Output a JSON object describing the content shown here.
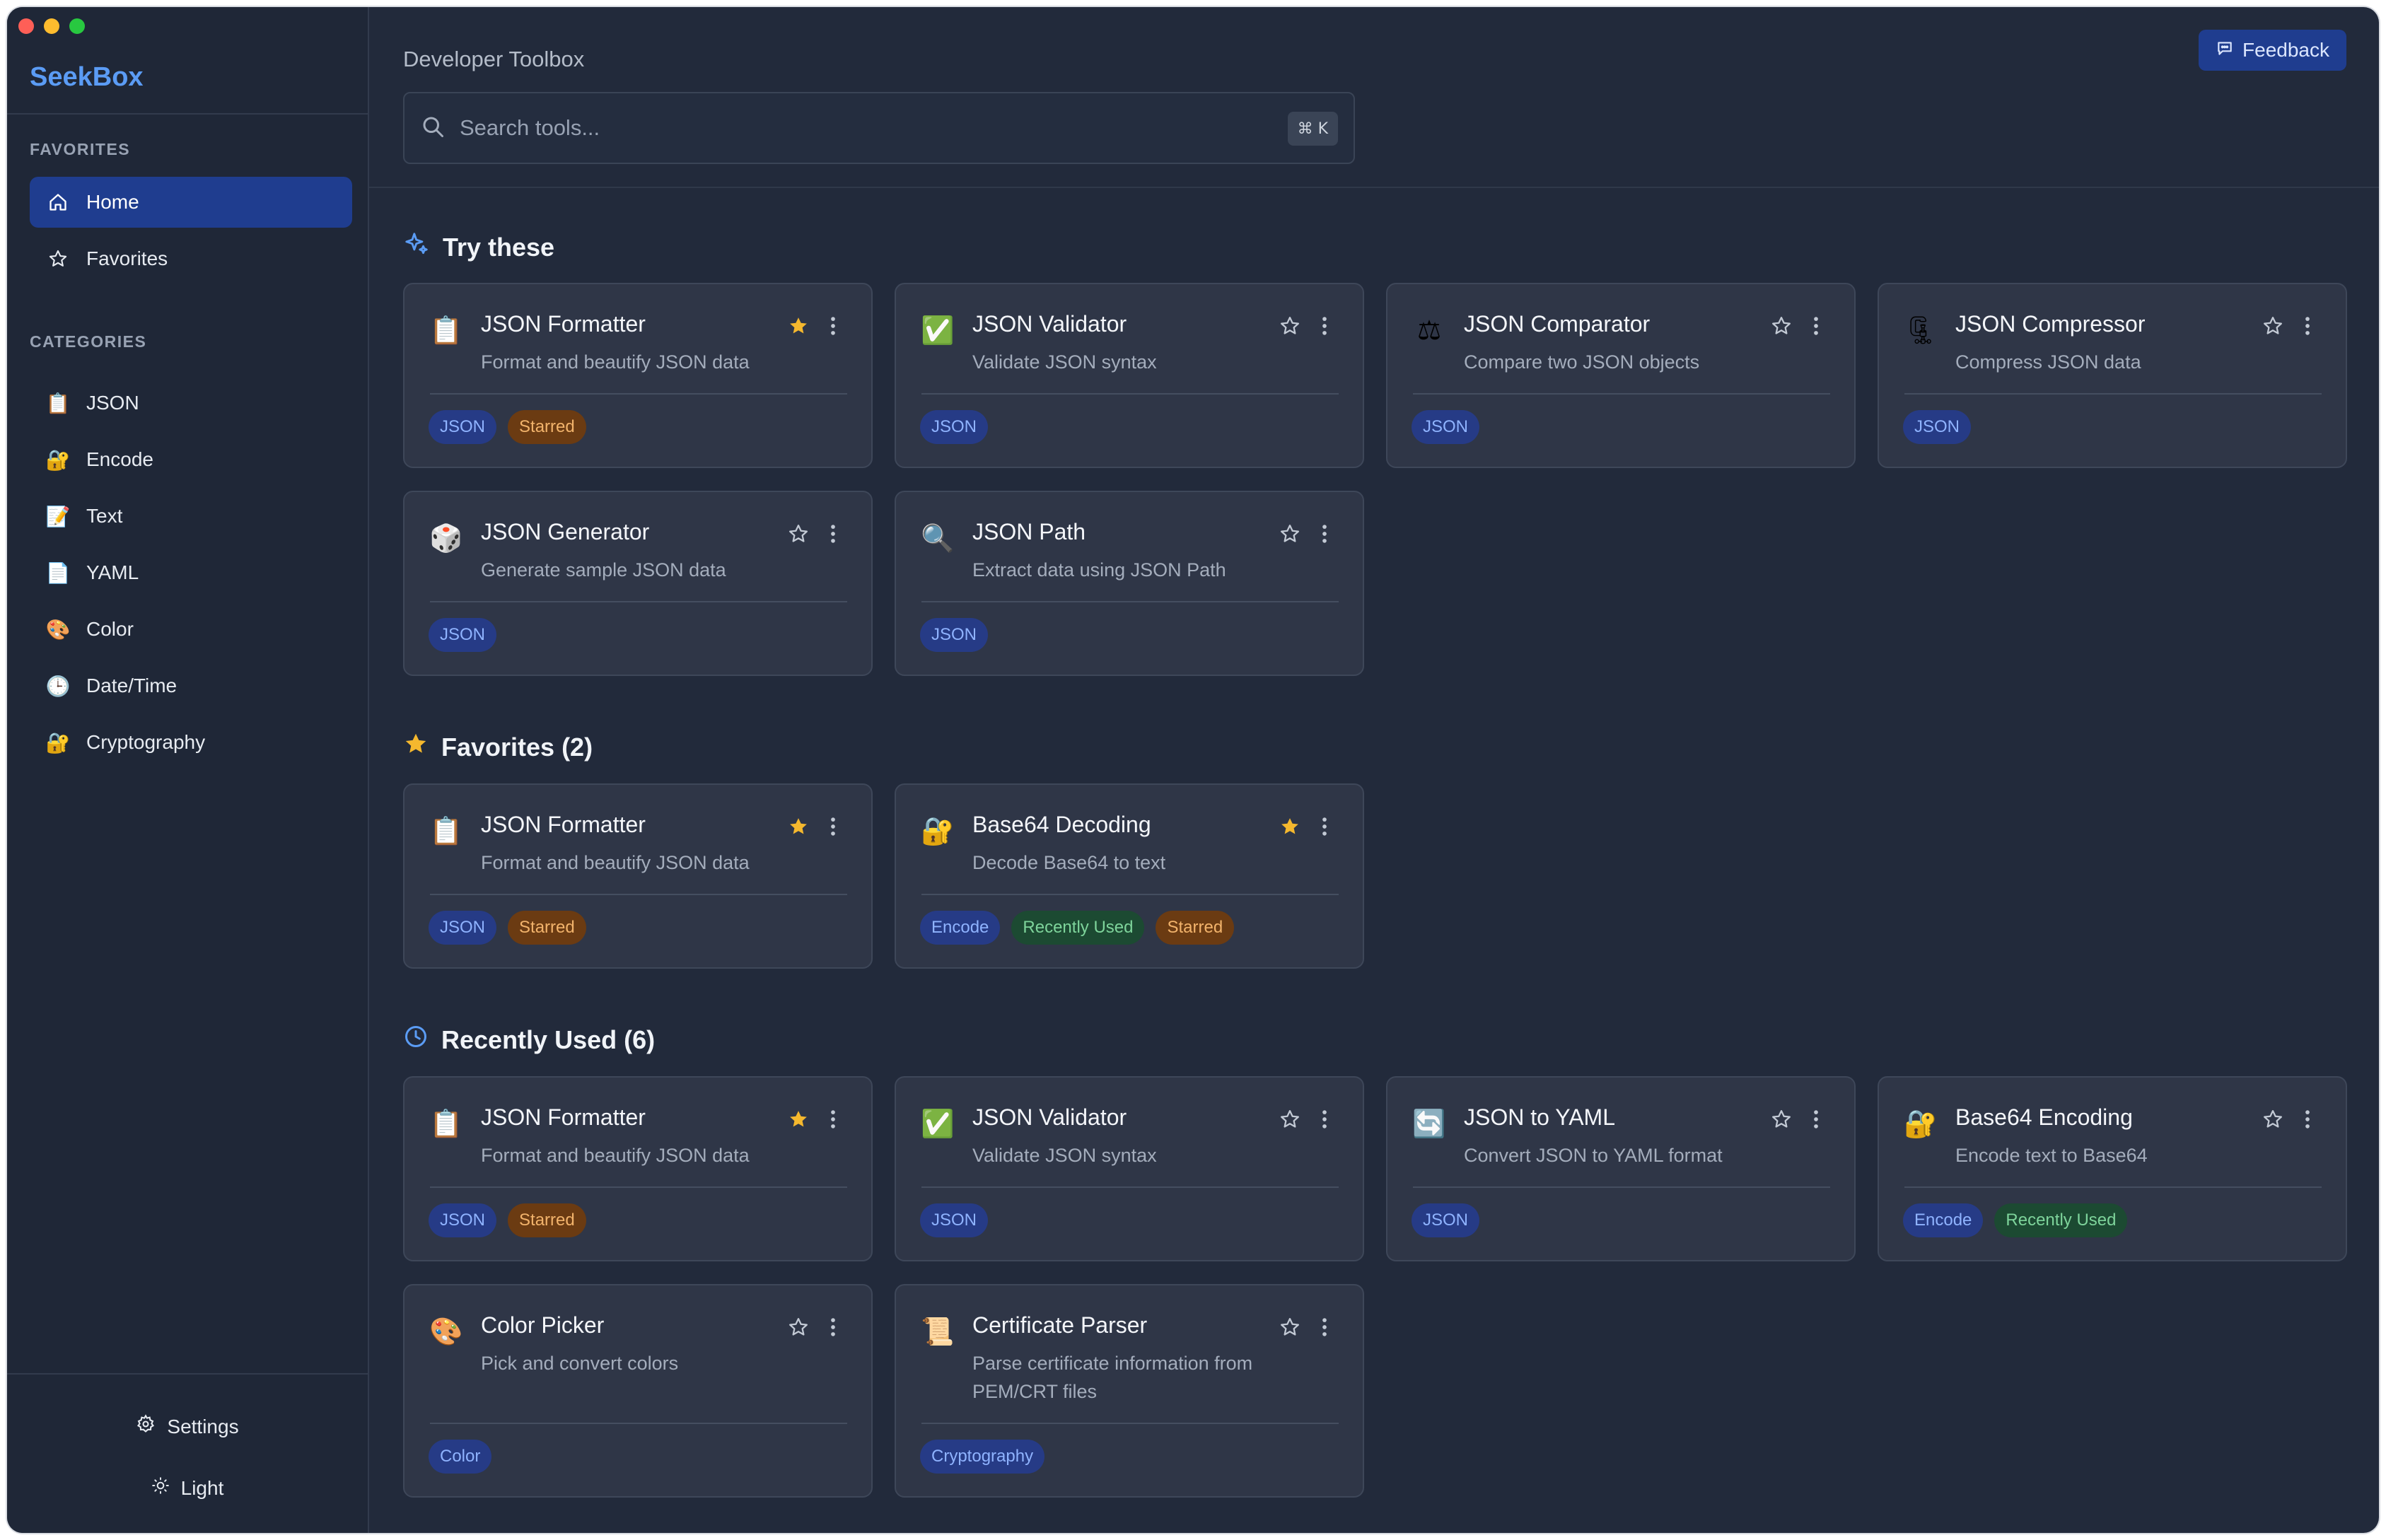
{
  "app": {
    "name": "SeekBox",
    "header_title": "Developer Toolbox",
    "feedback_label": "Feedback"
  },
  "search": {
    "placeholder": "Search tools...",
    "shortcut": "⌘ K"
  },
  "sidebar": {
    "favorites_label": "FAVORITES",
    "nav": [
      {
        "label": "Home",
        "icon": "home-icon",
        "active": true
      },
      {
        "label": "Favorites",
        "icon": "star-outline-icon",
        "active": false
      }
    ],
    "categories_label": "CATEGORIES",
    "categories": [
      {
        "label": "JSON",
        "icon": "clipboard-icon"
      },
      {
        "label": "Encode",
        "icon": "lock-key-icon"
      },
      {
        "label": "Text",
        "icon": "memo-icon"
      },
      {
        "label": "YAML",
        "icon": "page-icon"
      },
      {
        "label": "Color",
        "icon": "palette-icon"
      },
      {
        "label": "Date/Time",
        "icon": "clock-icon"
      },
      {
        "label": "Cryptography",
        "icon": "lock-key-icon"
      }
    ],
    "settings_label": "Settings",
    "theme_label": "Light"
  },
  "sections": {
    "try_these": {
      "title": "Try these",
      "cards": [
        {
          "title": "JSON Formatter",
          "desc": "Format and beautify JSON data",
          "icon": "clipboard-icon",
          "starred": true,
          "tags": [
            {
              "text": "JSON",
              "kind": "blue"
            },
            {
              "text": "Starred",
              "kind": "orange"
            }
          ]
        },
        {
          "title": "JSON Validator",
          "desc": "Validate JSON syntax",
          "icon": "check-box-icon",
          "starred": false,
          "tags": [
            {
              "text": "JSON",
              "kind": "blue"
            }
          ]
        },
        {
          "title": "JSON Comparator",
          "desc": "Compare two JSON objects",
          "icon": "scales-icon",
          "starred": false,
          "tags": [
            {
              "text": "JSON",
              "kind": "blue"
            }
          ]
        },
        {
          "title": "JSON Compressor",
          "desc": "Compress JSON data",
          "icon": "clamp-icon",
          "starred": false,
          "tags": [
            {
              "text": "JSON",
              "kind": "blue"
            }
          ]
        },
        {
          "title": "JSON Generator",
          "desc": "Generate sample JSON data",
          "icon": "dice-icon",
          "starred": false,
          "tags": [
            {
              "text": "JSON",
              "kind": "blue"
            }
          ]
        },
        {
          "title": "JSON Path",
          "desc": "Extract data using JSON Path",
          "icon": "magnifier-icon",
          "starred": false,
          "tags": [
            {
              "text": "JSON",
              "kind": "blue"
            }
          ]
        }
      ]
    },
    "favorites": {
      "title": "Favorites (2)",
      "cards": [
        {
          "title": "JSON Formatter",
          "desc": "Format and beautify JSON data",
          "icon": "clipboard-icon",
          "starred": true,
          "tags": [
            {
              "text": "JSON",
              "kind": "blue"
            },
            {
              "text": "Starred",
              "kind": "orange"
            }
          ]
        },
        {
          "title": "Base64 Decoding",
          "desc": "Decode Base64 to text",
          "icon": "lock-key-icon",
          "starred": true,
          "tags": [
            {
              "text": "Encode",
              "kind": "blue"
            },
            {
              "text": "Recently Used",
              "kind": "green"
            },
            {
              "text": "Starred",
              "kind": "orange"
            }
          ]
        }
      ]
    },
    "recent": {
      "title": "Recently Used (6)",
      "cards": [
        {
          "title": "JSON Formatter",
          "desc": "Format and beautify JSON data",
          "icon": "clipboard-icon",
          "starred": true,
          "tags": [
            {
              "text": "JSON",
              "kind": "blue"
            },
            {
              "text": "Starred",
              "kind": "orange"
            }
          ]
        },
        {
          "title": "JSON Validator",
          "desc": "Validate JSON syntax",
          "icon": "check-box-icon",
          "starred": false,
          "tags": [
            {
              "text": "JSON",
              "kind": "blue"
            }
          ]
        },
        {
          "title": "JSON to YAML",
          "desc": "Convert JSON to YAML format",
          "icon": "refresh-icon",
          "starred": false,
          "tags": [
            {
              "text": "JSON",
              "kind": "blue"
            }
          ]
        },
        {
          "title": "Base64 Encoding",
          "desc": "Encode text to Base64",
          "icon": "lock-key-icon",
          "starred": false,
          "tags": [
            {
              "text": "Encode",
              "kind": "blue"
            },
            {
              "text": "Recently Used",
              "kind": "green"
            }
          ]
        },
        {
          "title": "Color Picker",
          "desc": "Pick and convert colors",
          "icon": "palette-icon",
          "starred": false,
          "tags": [
            {
              "text": "Color",
              "kind": "blue"
            }
          ]
        },
        {
          "title": "Certificate Parser",
          "desc": "Parse certificate information from PEM/CRT files",
          "icon": "scroll-icon",
          "starred": false,
          "tags": [
            {
              "text": "Cryptography",
              "kind": "blue"
            }
          ]
        }
      ]
    }
  }
}
